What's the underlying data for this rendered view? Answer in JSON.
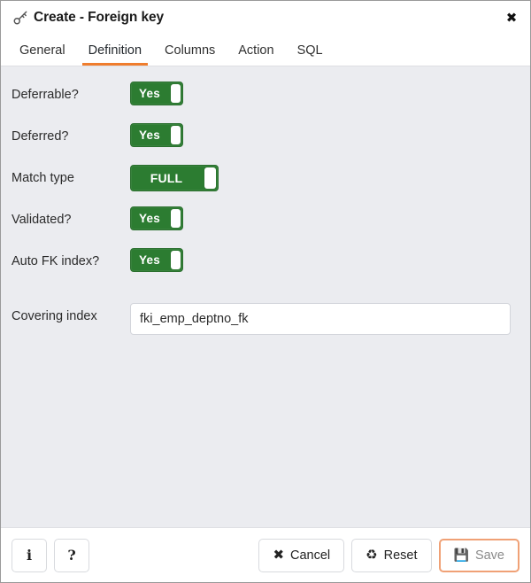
{
  "window": {
    "icon": "key-icon",
    "title": "Create - Foreign key",
    "close_label": "✖"
  },
  "tabs": [
    {
      "label": "General",
      "active": false
    },
    {
      "label": "Definition",
      "active": true
    },
    {
      "label": "Columns",
      "active": false
    },
    {
      "label": "Action",
      "active": false
    },
    {
      "label": "SQL",
      "active": false
    }
  ],
  "fields": {
    "deferrable": {
      "label": "Deferrable?",
      "value": "Yes"
    },
    "deferred": {
      "label": "Deferred?",
      "value": "Yes"
    },
    "match_type": {
      "label": "Match type",
      "value": "FULL"
    },
    "validated": {
      "label": "Validated?",
      "value": "Yes"
    },
    "auto_fk_index": {
      "label": "Auto FK index?",
      "value": "Yes"
    },
    "covering_index": {
      "label": "Covering index",
      "value": "fki_emp_deptno_fk",
      "placeholder": ""
    }
  },
  "footer": {
    "info_label": "i",
    "help_label": "?",
    "cancel_label": "Cancel",
    "cancel_icon": "✖",
    "reset_label": "Reset",
    "reset_icon": "♻",
    "save_label": "Save",
    "save_icon": "💾"
  },
  "colors": {
    "toggle_on": "#2c7c31",
    "tab_active_underline": "#ef7d2e",
    "save_focus_ring": "#f0a176",
    "body_background": "#ebecf0"
  }
}
